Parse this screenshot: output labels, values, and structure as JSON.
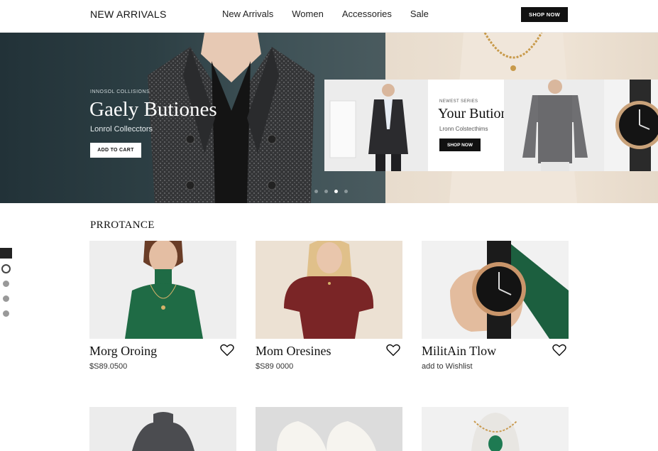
{
  "header": {
    "brand": "NEW ARRIVALS",
    "nav": [
      "New Arrivals",
      "Women",
      "Accessories",
      "Sale"
    ],
    "cta": "SHOP NOW"
  },
  "hero": {
    "kicker": "INNOSOL COLLISIONS",
    "title": "Gaely Butiones",
    "subtitle": "Lonrol Collecctors",
    "button": "ADD TO CART",
    "slides": 4,
    "active_slide": 3
  },
  "promo_card": {
    "kicker": "NEWEST SERIES",
    "title": "Your Butions",
    "subtitle": "Lronn Colstecthims",
    "button": "SHOP NOW"
  },
  "section": {
    "title": "PRROTANCE"
  },
  "products": [
    {
      "name": "Morg Oroing",
      "price": "$S89.0500",
      "image": "green-turtleneck"
    },
    {
      "name": "Mom Oresines",
      "price": "$S89 0000",
      "image": "burgundy-top"
    },
    {
      "name": "MilitAin Tlow",
      "price": "add to Wishlist",
      "image": "black-gold-watch"
    }
  ],
  "products_row2": [
    {
      "image": "grey-turtleneck"
    },
    {
      "image": "white-sneakers"
    },
    {
      "image": "emerald-necklace"
    }
  ],
  "colors": {
    "hero_dark": "#2d3f44",
    "accent": "#111111",
    "green": "#1f6b45",
    "burgundy": "#7a2526"
  }
}
